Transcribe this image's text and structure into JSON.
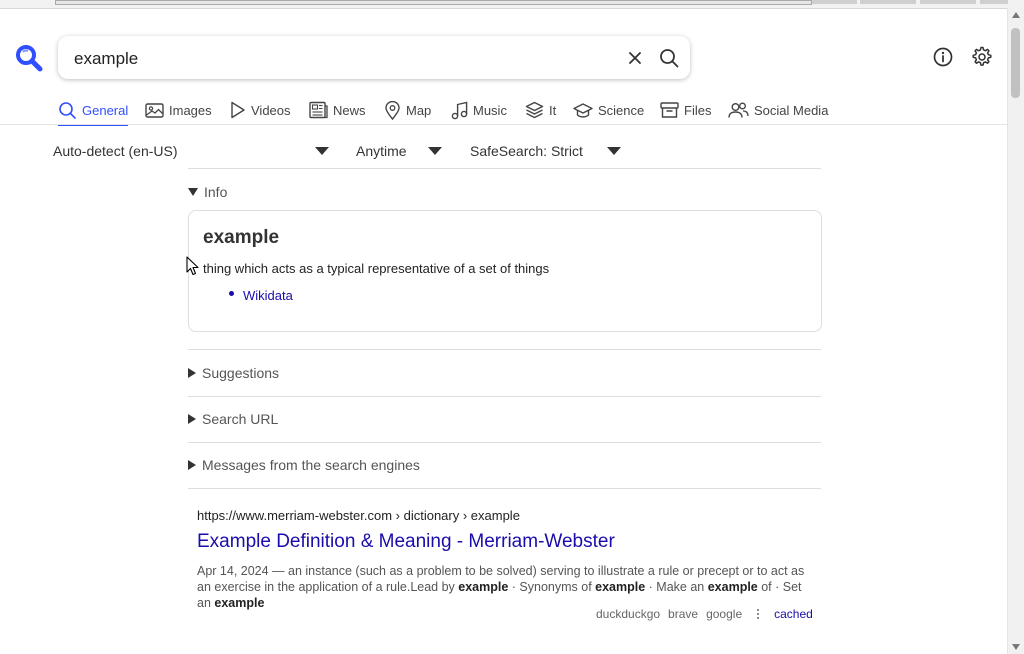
{
  "search": {
    "query": "example"
  },
  "tabs": [
    {
      "label": "General",
      "icon": "search-icon",
      "active": true
    },
    {
      "label": "Images",
      "icon": "image-icon",
      "active": false
    },
    {
      "label": "Videos",
      "icon": "play-icon",
      "active": false
    },
    {
      "label": "News",
      "icon": "newspaper-icon",
      "active": false
    },
    {
      "label": "Map",
      "icon": "map-pin-icon",
      "active": false
    },
    {
      "label": "Music",
      "icon": "music-note-icon",
      "active": false
    },
    {
      "label": "It",
      "icon": "layers-icon",
      "active": false
    },
    {
      "label": "Science",
      "icon": "graduation-cap-icon",
      "active": false
    },
    {
      "label": "Files",
      "icon": "archive-icon",
      "active": false
    },
    {
      "label": "Social Media",
      "icon": "people-icon",
      "active": false
    }
  ],
  "filters": {
    "language": "Auto-detect (en-US)",
    "time_range": "Anytime",
    "safesearch": "SafeSearch: Strict"
  },
  "infobox": {
    "section_label": "Info",
    "title": "example",
    "description": "thing which acts as a typical representative of a set of things",
    "links": [
      "Wikidata"
    ]
  },
  "sections": {
    "suggestions": "Suggestions",
    "search_url": "Search URL",
    "engine_messages": "Messages from the search engines"
  },
  "results": [
    {
      "url_host": "https://www.merriam-webster.com",
      "url_path": " › dictionary › example",
      "title": "Example Definition & Meaning - Merriam-Webster",
      "snippet_parts": [
        {
          "text": "Apr 14, 2024 — an instance (such as a problem to be solved) serving to illustrate a rule or precept or to act as an exercise in the application of a rule.Lead by ",
          "bold": false
        },
        {
          "text": "example",
          "bold": true
        },
        {
          "text": " · Synonyms of ",
          "bold": false
        },
        {
          "text": "example",
          "bold": true
        },
        {
          "text": " · Make an ",
          "bold": false
        },
        {
          "text": "example",
          "bold": true
        },
        {
          "text": " of · Set an ",
          "bold": false
        },
        {
          "text": "example",
          "bold": true
        }
      ],
      "engines": [
        "duckduckgo",
        "brave",
        "google"
      ],
      "cached_label": "cached"
    }
  ],
  "colors": {
    "accent": "#3050ff",
    "link": "#1a0dab"
  }
}
